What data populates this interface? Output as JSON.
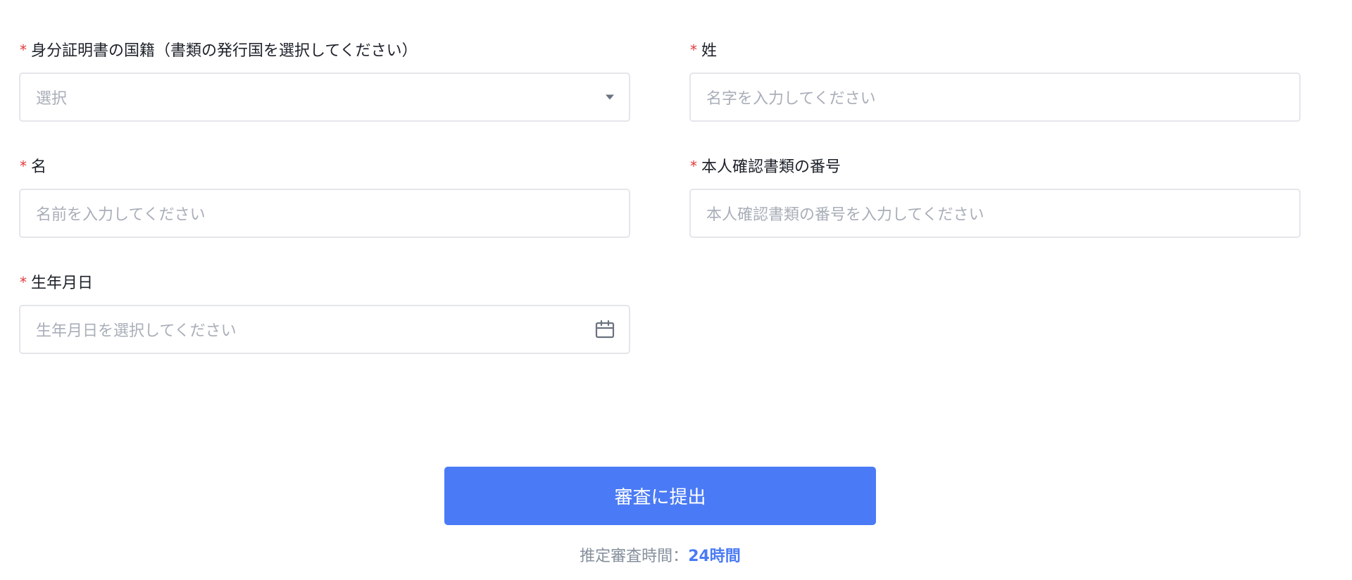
{
  "form": {
    "nationality": {
      "required_mark": "*",
      "label": "身分証明書の国籍（書類の発行国を選択してください）",
      "placeholder": "選択",
      "icon": "caret-down-icon"
    },
    "last_name": {
      "required_mark": "*",
      "label": "姓",
      "placeholder": "名字を入力してください"
    },
    "first_name": {
      "required_mark": "*",
      "label": "名",
      "placeholder": "名前を入力してください"
    },
    "id_number": {
      "required_mark": "*",
      "label": "本人確認書類の番号",
      "placeholder": "本人確認書類の番号を入力してください"
    },
    "birth_date": {
      "required_mark": "*",
      "label": "生年月日",
      "placeholder": "生年月日を選択してください",
      "icon": "calendar-icon"
    }
  },
  "submit": {
    "label": "審査に提出"
  },
  "review": {
    "label": "推定審査時間：",
    "value": "24時間"
  },
  "colors": {
    "accent": "#4a7af5",
    "required": "#e4393c",
    "border": "#e5e6eb",
    "placeholder": "#a9aeb8"
  }
}
